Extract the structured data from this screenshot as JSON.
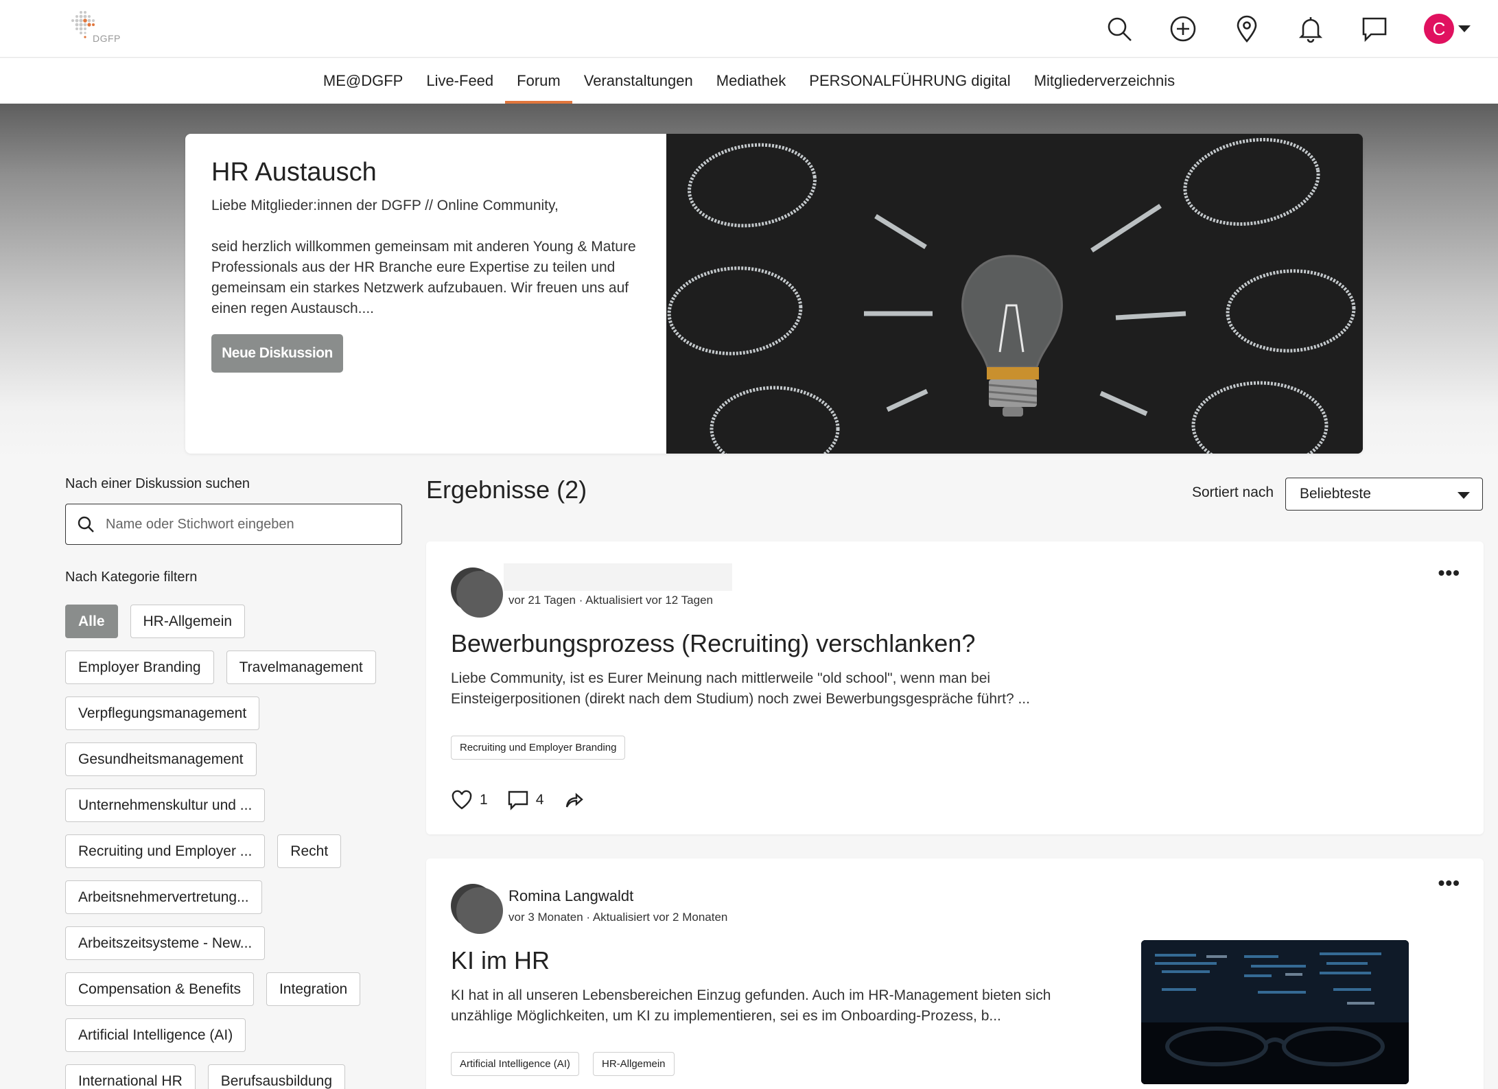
{
  "brand": {
    "logo_text": "DGFP",
    "accent": "#e0763d",
    "avatar_color": "#e0115f",
    "button_grey": "#8a8d8c"
  },
  "topbar": {
    "icons": [
      "search-icon",
      "add-icon",
      "location-pin-icon",
      "bell-icon",
      "chat-icon"
    ],
    "avatar_initial": "C"
  },
  "nav": {
    "items": [
      {
        "label": "ME@DGFP"
      },
      {
        "label": "Live-Feed"
      },
      {
        "label": "Forum",
        "active": true
      },
      {
        "label": "Veranstaltungen"
      },
      {
        "label": "Mediathek"
      },
      {
        "label": "PERSONALFÜHRUNG digital"
      },
      {
        "label": "Mitgliederverzeichnis"
      }
    ]
  },
  "hero": {
    "title": "HR Austausch",
    "body": "Liebe Mitglieder:innen der DGFP // Online Community,\n\nseid herzlich willkommen gemeinsam mit anderen Young & Mature Professionals aus der HR Branche eure Expertise zu teilen und gemeinsam ein starkes Netzwerk aufzubauen. Wir freuen uns auf einen regen Austausch....",
    "button_label": "Neue Diskussion",
    "image": "lightbulb-chalkboard-image"
  },
  "sidebar": {
    "search_label": "Nach einer Diskussion suchen",
    "search_placeholder": "Name oder Stichwort eingeben",
    "filter_label": "Nach Kategorie filtern",
    "chip_rows": [
      [
        "Alle",
        "HR-Allgemein"
      ],
      [
        "Employer Branding",
        "Travelmanagement"
      ],
      [
        "Verpflegungsmanagement"
      ],
      [
        "Gesundheitsmanagement"
      ],
      [
        "Unternehmenskultur und ..."
      ],
      [
        "Recruiting und Employer ...",
        "Recht"
      ],
      [
        "Arbeitsnehmervertretung..."
      ],
      [
        "Arbeitszeitsysteme - New..."
      ],
      [
        "Compensation & Benefits",
        "Integration"
      ],
      [
        "Artificial Intelligence (AI)"
      ],
      [
        "International HR",
        "Berufsausbildung"
      ]
    ],
    "active_chip": "Alle"
  },
  "results": {
    "title": "Ergebnisse (2)",
    "sort_label": "Sortiert nach",
    "sort_value": "Beliebteste"
  },
  "posts": [
    {
      "author": "",
      "meta": "vor 21 Tagen · Aktualisiert vor 12 Tagen",
      "title": "Bewerbungsprozess (Recruiting) verschlanken?",
      "body": "Liebe Community, ist es Eurer Meinung nach mittlerweile \"old school\", wenn man bei Einsteigerpositionen (direkt nach dem Studium) noch zwei Bewerbungsgespräche führt? ...",
      "tags": [
        "Recruiting und Employer Branding"
      ],
      "likes": "1",
      "comments": "4"
    },
    {
      "author": "Romina Langwaldt",
      "meta": "vor 3 Monaten · Aktualisiert vor 2 Monaten",
      "title": "KI im HR",
      "body": "KI hat in all unseren Lebensbereichen Einzug gefunden. Auch im HR-Management bieten sich unzählige Möglichkeiten, um KI zu implementieren, sei es im Onboarding-Prozess, b...",
      "tags": [
        "Artificial Intelligence (AI)",
        "HR-Allgemein"
      ],
      "image": "code-screen-glasses-image"
    }
  ]
}
